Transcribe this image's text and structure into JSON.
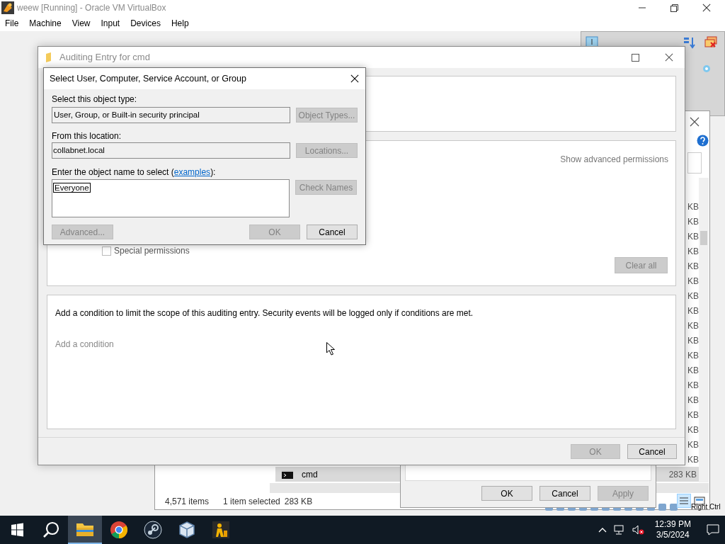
{
  "host_window": {
    "title": "weew [Running] - Oracle VM VirtualBox",
    "menu": [
      "File",
      "Machine",
      "View",
      "Input",
      "Devices",
      "Help"
    ],
    "host_key": "Right Ctrl"
  },
  "explorer": {
    "size_column": [
      "KB",
      "KB",
      "KB",
      "KB",
      "KB",
      "KB",
      "KB",
      "KB",
      "KB",
      "KB",
      "KB",
      "KB",
      "KB",
      "KB",
      "KB",
      "KB",
      "KB",
      "KB"
    ],
    "selected_row": {
      "name": "cmd",
      "size": "283 KB",
      "selected": true
    },
    "status": {
      "items": "4,571 items",
      "selection": "1 item selected",
      "size": "283 KB"
    }
  },
  "properties": {
    "buttons": [
      {
        "label": "OK",
        "disabled": false
      },
      {
        "label": "Cancel",
        "disabled": false
      },
      {
        "label": "Apply",
        "disabled": true
      }
    ]
  },
  "auditing": {
    "title": "Auditing Entry for cmd",
    "show_advanced": "Show advanced permissions",
    "special_permissions": {
      "label": "Special permissions",
      "checked": false
    },
    "clear_all": {
      "label": "Clear all",
      "disabled": true
    },
    "condition_text": "Add a condition to limit the scope of this auditing entry. Security events will be logged only if conditions are met.",
    "add_condition": "Add a condition",
    "buttons": [
      {
        "label": "OK",
        "disabled": true
      },
      {
        "label": "Cancel",
        "disabled": false
      }
    ]
  },
  "select_dialog": {
    "title": "Select User, Computer, Service Account, or Group",
    "object_type_label": "Select this object type:",
    "object_type": "User, Group, or Built-in security principal",
    "object_types_button": {
      "label": "Object Types...",
      "disabled": true
    },
    "location_label": "From this location:",
    "location": "collabnet.local",
    "locations_button": {
      "label": "Locations...",
      "disabled": true
    },
    "name_label_start": "Enter the object name to select (",
    "examples_link": "examples",
    "name_label_end": "):",
    "name_value": "Everyone",
    "check_names_button": {
      "label": "Check Names",
      "disabled": true
    },
    "advanced_button": {
      "label": "Advanced...",
      "disabled": true
    },
    "ok_button": {
      "label": "OK",
      "disabled": true
    },
    "cancel_button": {
      "label": "Cancel",
      "disabled": false
    }
  },
  "taskbar": {
    "apps": [
      {
        "kind": "search",
        "selected": false
      },
      {
        "kind": "explorer",
        "selected": true
      },
      {
        "kind": "chrome",
        "selected": false
      },
      {
        "kind": "steam",
        "selected": false
      },
      {
        "kind": "virtualbox",
        "selected": false
      },
      {
        "kind": "app",
        "selected": false
      }
    ],
    "time": "12:39 PM",
    "date": "3/5/2024"
  }
}
